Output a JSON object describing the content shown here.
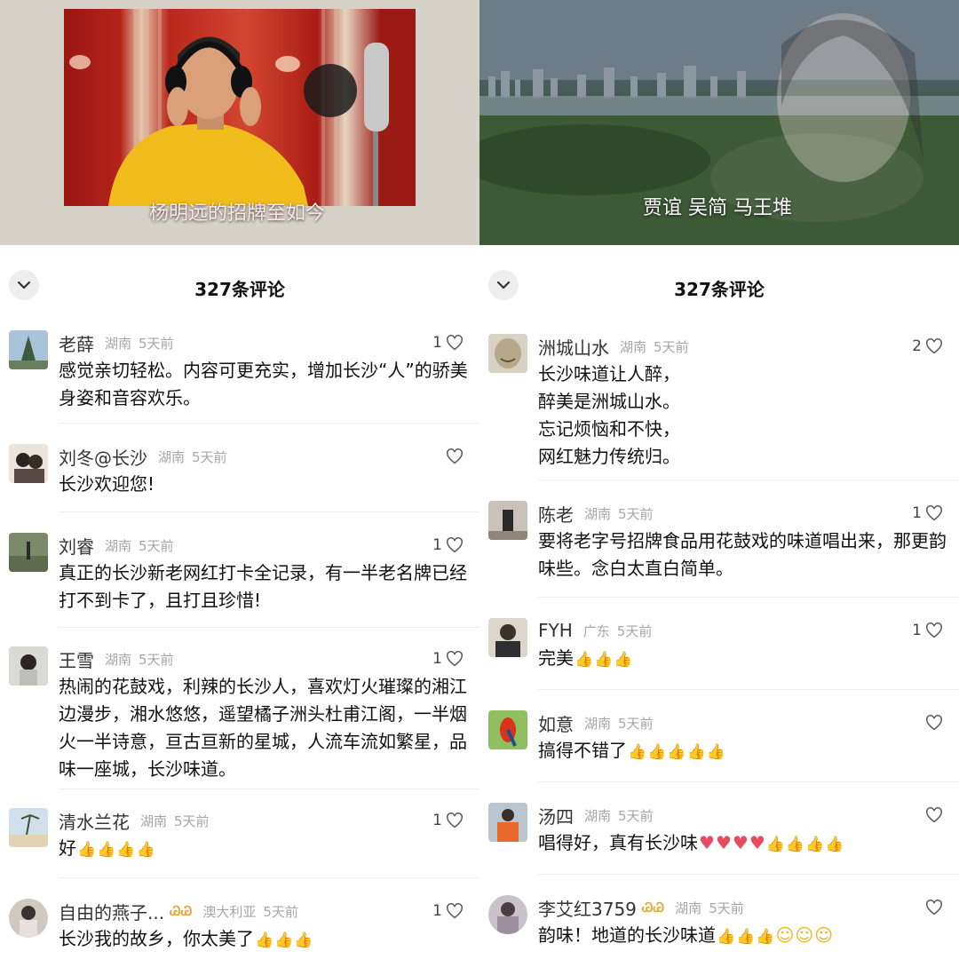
{
  "left": {
    "video_caption": "杨明远的招牌至如今",
    "title": "327条评论",
    "comments": [
      {
        "user": "老薛",
        "region": "湖南",
        "time": "5天前",
        "likes": "1",
        "text": "感觉亲切轻松。内容可更充实，增加长沙“人”的骄美身姿和音容欢乐。"
      },
      {
        "user": "刘冬@长沙",
        "region": "湖南",
        "time": "5天前",
        "likes": "",
        "text": "长沙欢迎您!"
      },
      {
        "user": "刘睿",
        "region": "湖南",
        "time": "5天前",
        "likes": "1",
        "text": "真正的长沙新老网红打卡全记录，有一半老名牌已经打不到卡了，且打且珍惜!"
      },
      {
        "user": "王雪",
        "region": "湖南",
        "time": "5天前",
        "likes": "1",
        "text": "热闹的花鼓戏，利辣的长沙人，喜欢灯火璀璨的湘江边漫步，湘水悠悠，遥望橘子洲头杜甫江阁，一半烟火一半诗意，亘古亘新的星城，人流车流如繁星，品味一座城，长沙味道。"
      },
      {
        "user": "清水兰花",
        "region": "湖南",
        "time": "5天前",
        "likes": "1",
        "text": "好"
      },
      {
        "user": "自由的燕子...",
        "region": "澳大利亚",
        "time": "5天前",
        "likes": "1",
        "text": "长沙我的故乡，你太美了"
      }
    ]
  },
  "right": {
    "video_caption": "贾谊 吴简 马王堆",
    "title": "327条评论",
    "comments": [
      {
        "user": "洲城山水",
        "region": "湖南",
        "time": "5天前",
        "likes": "2",
        "text": "长沙味道让人醉，\n醉美是洲城山水。\n忘记烦恼和不快，\n网红魅力传统归。"
      },
      {
        "user": "陈老",
        "region": "湖南",
        "time": "5天前",
        "likes": "1",
        "text": "要将老字号招牌食品用花鼓戏的味道唱出来，那更韵味些。念白太直白简单。"
      },
      {
        "user": "FYH",
        "region": "广东",
        "time": "5天前",
        "likes": "1",
        "text": "完美"
      },
      {
        "user": "如意",
        "region": "湖南",
        "time": "5天前",
        "likes": "",
        "text": "搞得不错了"
      },
      {
        "user": "汤四",
        "region": "湖南",
        "time": "5天前",
        "likes": "",
        "text": "唱得好，真有长沙味"
      },
      {
        "user": "李艾红3759",
        "region": "湖南",
        "time": "5天前",
        "likes": "",
        "text": "韵味！地道的长沙味道"
      }
    ]
  },
  "icons": {
    "heart": "heart-outline-icon",
    "chevron": "chevron-down-icon",
    "thumbs": "thumbs-up-emoji",
    "red_heart": "red-heart-emoji",
    "smile": "smile-emoji",
    "badge": "vip-badge-icon"
  },
  "colors": {
    "meta": "#a6a6a6",
    "badge": "#e8a73b",
    "heart_emoji": "#e84a5f"
  }
}
